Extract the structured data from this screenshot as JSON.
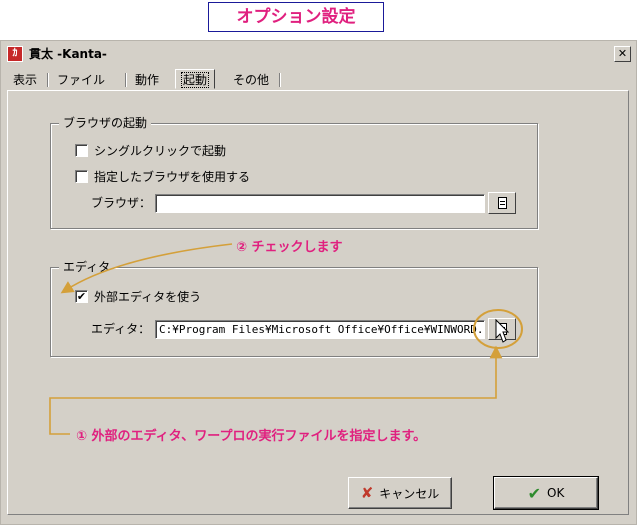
{
  "page_title": "オプション設定",
  "window": {
    "title": "貫太 -Kanta-",
    "app_icon_glyph": "ｶ",
    "close_glyph": "✕"
  },
  "tabs": [
    {
      "label": "表示"
    },
    {
      "label": "ファイル"
    },
    {
      "label": "動作"
    },
    {
      "label": "起動",
      "active": true
    },
    {
      "label": "その他"
    }
  ],
  "browser_group": {
    "label": "ブラウザの起動",
    "single_click": {
      "label": "シングルクリックで起動",
      "checked": false
    },
    "use_specified": {
      "label": "指定したブラウザを使用する",
      "checked": false
    },
    "browser_field_label": "ブラウザ：",
    "browser_path": ""
  },
  "editor_group": {
    "label": "エディタ",
    "use_external": {
      "label": "外部エディタを使う",
      "checked": true,
      "mark": "✔"
    },
    "editor_field_label": "エディタ：",
    "editor_path": "C:¥Program Files¥Microsoft Office¥Office¥WINWORD.EXE"
  },
  "buttons": {
    "cancel": "キャンセル",
    "ok": "OK",
    "cancel_icon": "✘",
    "ok_icon": "✔"
  },
  "annotations": {
    "step2": "② チェックします",
    "step1": "① 外部のエディタ、ワープロの実行ファイルを指定します。"
  },
  "colors": {
    "annotation": "#e0207f",
    "arrow": "#d4a03a",
    "dialog_bg": "#d4d0c8"
  }
}
